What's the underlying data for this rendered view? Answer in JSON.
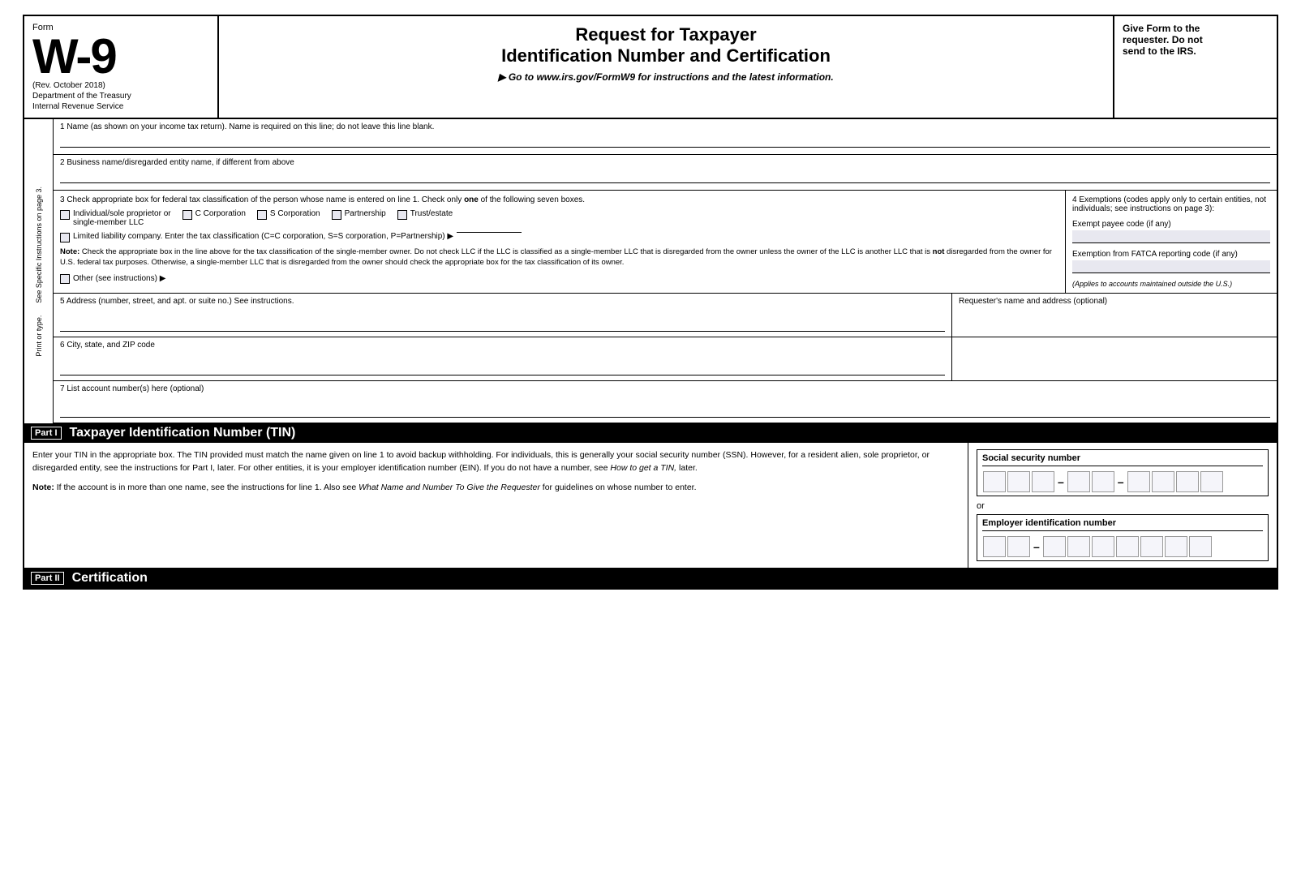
{
  "header": {
    "form_label": "Form",
    "form_number": "W-9",
    "rev_date": "(Rev. October 2018)",
    "dept_line1": "Department of the Treasury",
    "dept_line2": "Internal Revenue Service",
    "title_line1": "Request for Taxpayer",
    "title_line2": "Identification Number and Certification",
    "instruction": "▶ Go to www.irs.gov/FormW9 for instructions and the latest information.",
    "give_form_line1": "Give Form to the",
    "give_form_line2": "requester. Do not",
    "give_form_line3": "send to the IRS."
  },
  "side_label": {
    "line1": "Print or type.",
    "line2": "See Specific Instructions on page 3."
  },
  "fields": {
    "field1_label": "1  Name (as shown on your income tax return). Name is required on this line; do not leave this line blank.",
    "field2_label": "2  Business name/disregarded entity name, if different from above",
    "field3_label": "3  Check appropriate box for federal tax classification of the person whose name is entered on line 1. Check only",
    "field3_label_one": "one",
    "field3_label_rest": " of the following seven boxes.",
    "classification_options": [
      {
        "id": "indiv",
        "label": "Individual/sole proprietor or\nsingle-member LLC"
      },
      {
        "id": "c_corp",
        "label": "C Corporation"
      },
      {
        "id": "s_corp",
        "label": "S Corporation"
      },
      {
        "id": "partnership",
        "label": "Partnership"
      },
      {
        "id": "trust",
        "label": "Trust/estate"
      }
    ],
    "llc_label": "Limited liability company. Enter the tax classification (C=C corporation, S=S corporation, P=Partnership) ▶",
    "note_label": "Note:",
    "note_text": " Check the appropriate box in the line above for the tax classification of the single-member owner.  Do not check LLC if the LLC is classified as a single-member LLC that is disregarded from the owner unless the owner of the LLC is another LLC that is",
    "note_bold": " not",
    "note_text2": " disregarded from the owner for U.S. federal tax purposes. Otherwise, a single-member LLC that is disregarded from the owner should check the appropriate box for the tax classification of its owner.",
    "other_label": "Other (see instructions) ▶",
    "field4_label": "4  Exemptions (codes apply only to certain entities, not individuals; see instructions on page 3):",
    "exempt_payee_label": "Exempt payee code (if any)",
    "fatca_label": "Exemption from FATCA reporting code (if any)",
    "applies_text": "(Applies to accounts maintained outside the U.S.)",
    "field5_label": "5  Address (number, street, and apt. or suite no.) See instructions.",
    "requesters_label": "Requester's name and address (optional)",
    "field6_label": "6  City, state, and ZIP code",
    "field7_label": "7  List account number(s) here (optional)"
  },
  "part1": {
    "badge": "Part I",
    "title": "Taxpayer Identification Number (TIN)",
    "body_text": "Enter your TIN in the appropriate box. The TIN provided must match the name given on line 1 to avoid backup withholding. For individuals, this is generally your social security number (SSN). However, for a resident alien, sole proprietor, or disregarded entity, see the instructions for Part I, later. For other entities, it is your employer identification number (EIN). If you do not have a number, see",
    "body_italic": " How to get a TIN,",
    "body_text2": " later.",
    "note_label": "Note:",
    "note_text": " If the account is in more than one name, see the instructions for line 1. Also see",
    "note_italic": " What Name and Number To Give the Requester",
    "note_text2": " for guidelines on whose number to enter.",
    "ssn_label": "Social security number",
    "ssn_boxes_group1": 3,
    "ssn_boxes_group2": 2,
    "ssn_boxes_group3": 4,
    "or_text": "or",
    "ein_label": "Employer identification number",
    "ein_boxes_group1": 2,
    "ein_boxes_group2": 7
  },
  "part2": {
    "badge": "Part II",
    "title": "Certification"
  }
}
